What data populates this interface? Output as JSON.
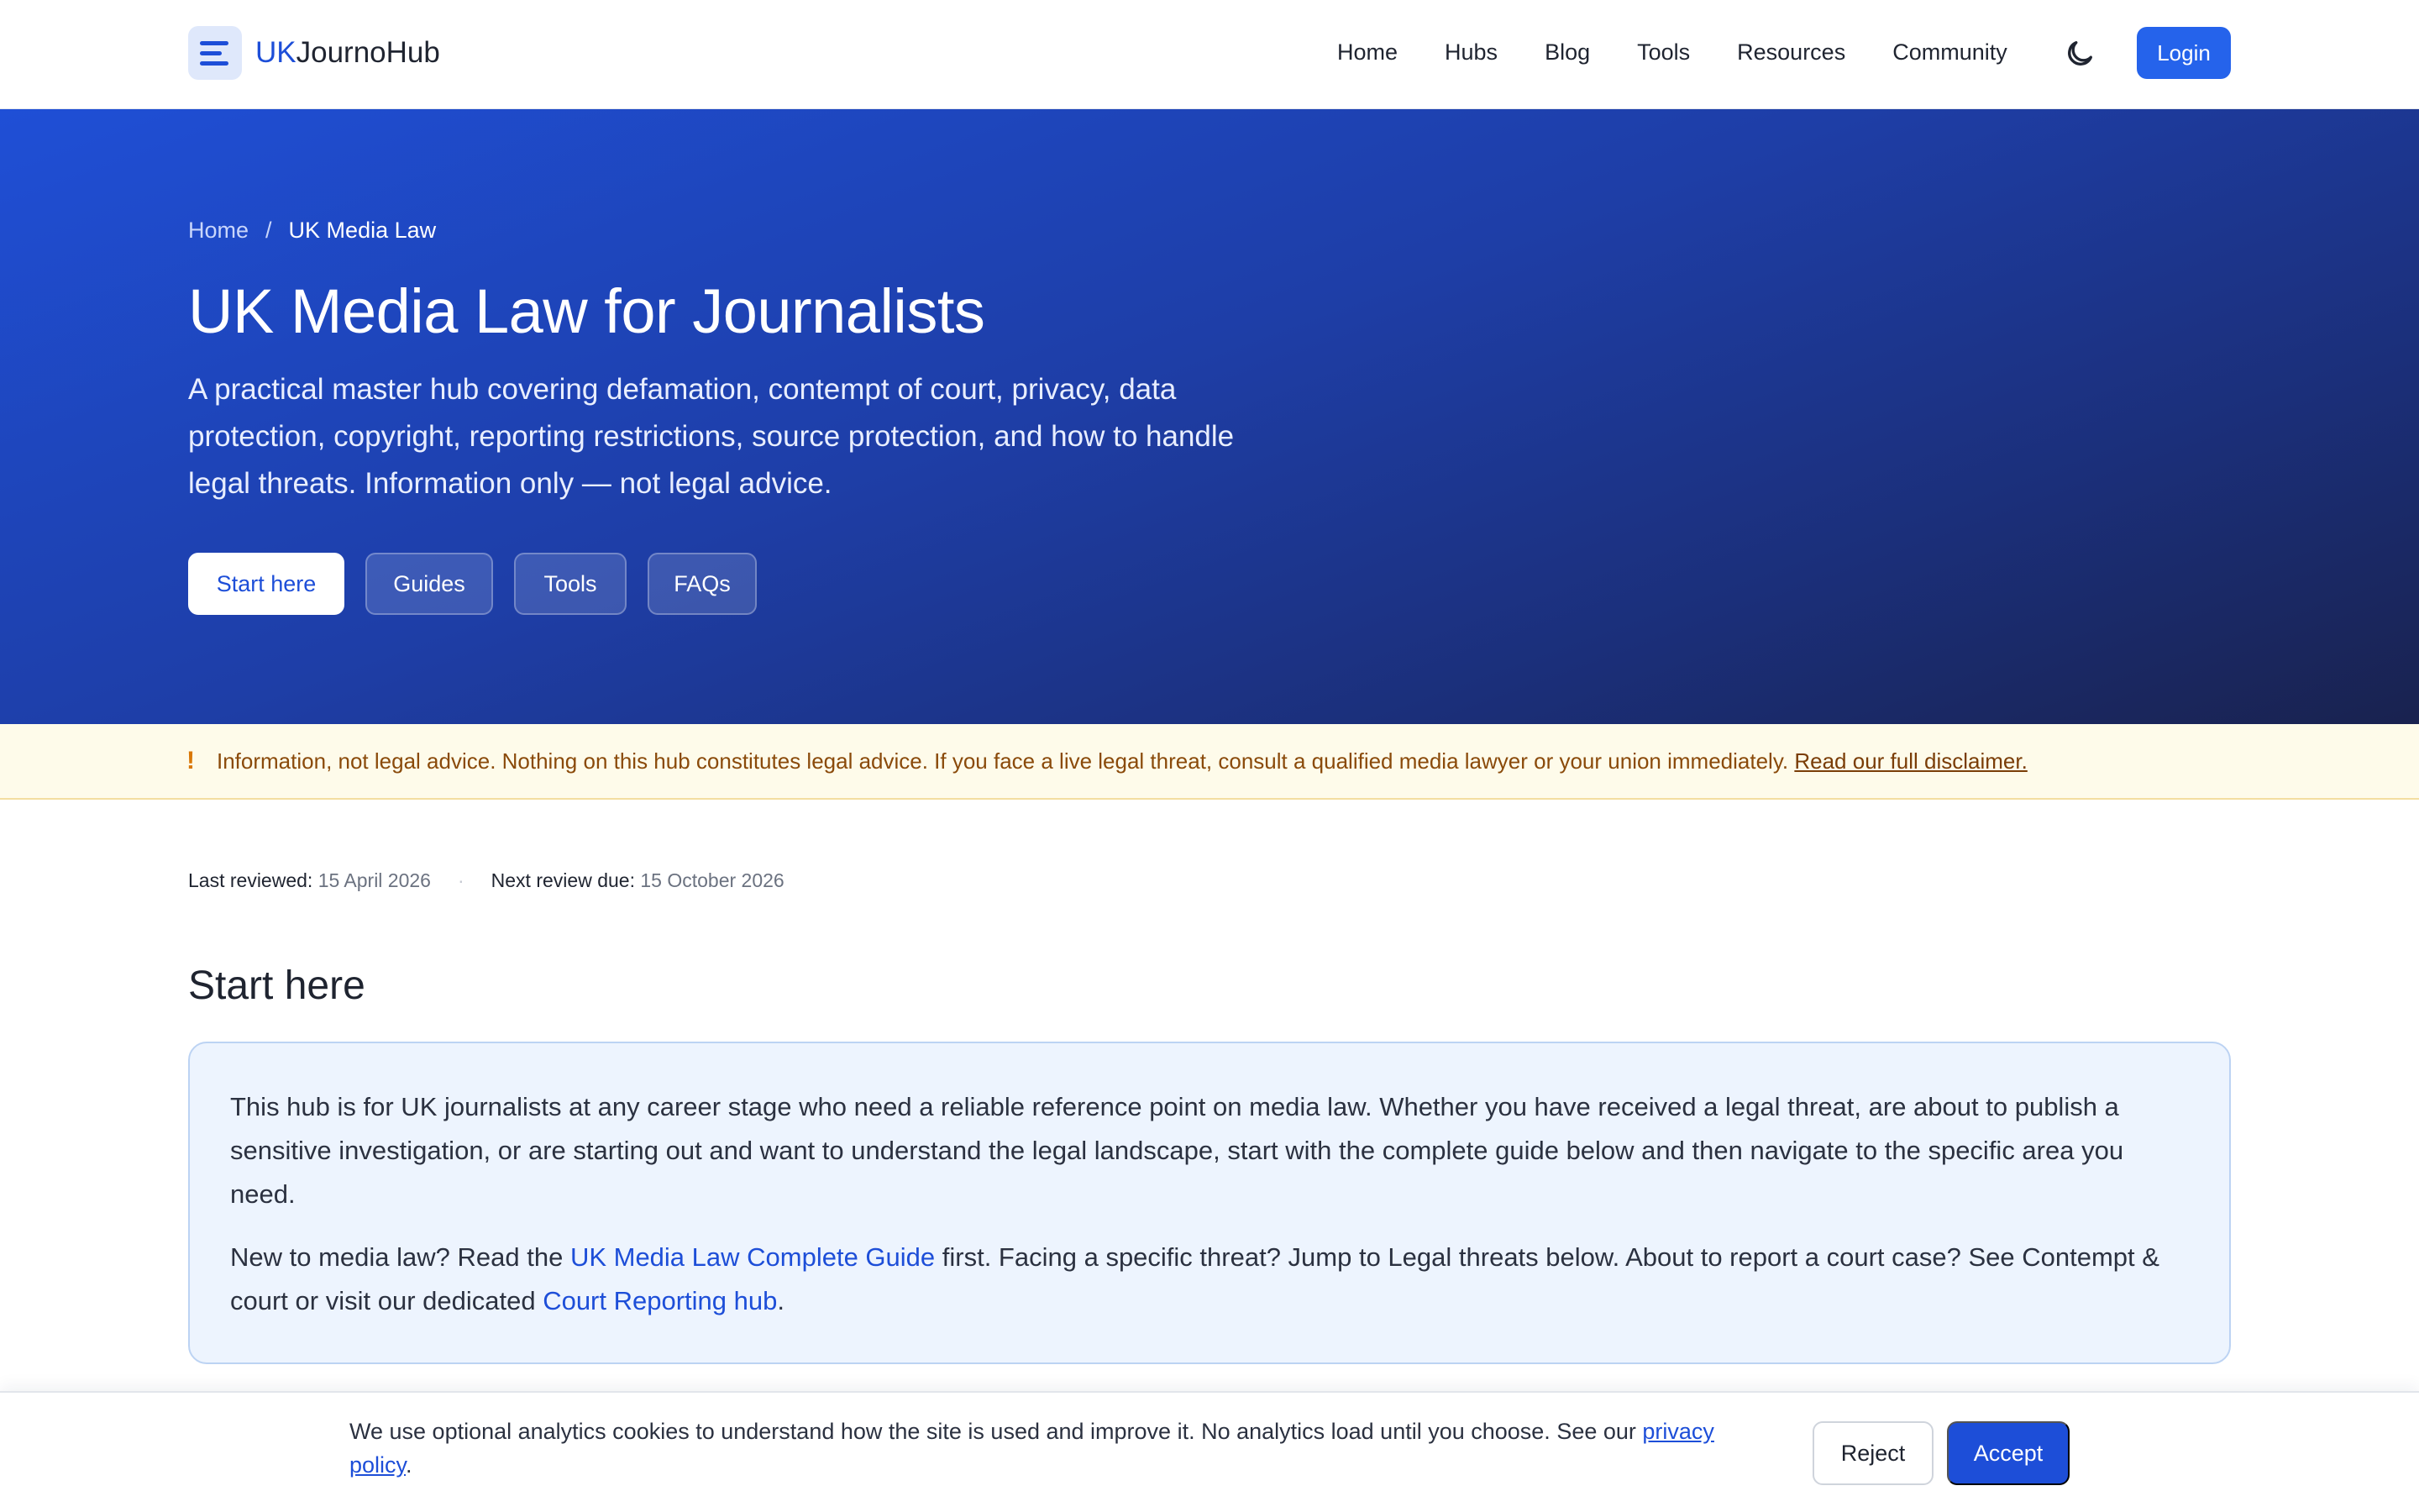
{
  "nav": {
    "logo_prefix": "UK",
    "logo_suffix": "JournoHub",
    "links": [
      "Home",
      "Hubs",
      "Blog",
      "Tools",
      "Resources",
      "Community"
    ],
    "theme_icon": "moon-icon",
    "login_label": "Login"
  },
  "hero": {
    "breadcrumb": {
      "home": "Home",
      "separator": "/",
      "current": "UK Media Law"
    },
    "title": "UK Media Law for Journalists",
    "subtitle": "A practical master hub covering defamation, contempt of court, privacy, data protection, copyright, reporting restrictions, source protection, and how to handle legal threats. Information only — not legal advice.",
    "buttons": {
      "start": "Start here",
      "guides": "Guides",
      "tools": "Tools",
      "faqs": "FAQs"
    }
  },
  "disclaimer": {
    "icon": "!",
    "text": "Information, not legal advice. Nothing on this hub constitutes legal advice. If you face a live legal threat, consult a qualified media lawyer or your union immediately.",
    "link": "Read our full disclaimer."
  },
  "meta": {
    "reviewed_label": "Last reviewed:",
    "reviewed_value": "15 April 2026",
    "next_label": "Next review due:",
    "next_value": "15 October 2026"
  },
  "start_here": {
    "title": "Start here",
    "p1": "This hub is for UK journalists at any career stage who need a reliable reference point on media law. Whether you have received a legal threat, are about to publish a sensitive investigation, or are starting out and want to understand the legal landscape, start with the complete guide below and then navigate to the specific area you need.",
    "p2_a": "New to media law? Read the ",
    "p2_link1": "UK Media Law Complete Guide",
    "p2_b": " first. Facing a specific threat? Jump to Legal threats below. About to report a court case? See Contempt & court or visit our dedicated ",
    "p2_link2": "Court Reporting hub",
    "p2_c": "."
  },
  "cookie": {
    "text": "We use optional analytics cookies to understand how the site is used and improve it. No analytics load until you choose. See our ",
    "link": "privacy policy",
    "end": ".",
    "reject": "Reject",
    "accept": "Accept"
  },
  "colors": {
    "brand": "#1d4ed8",
    "login_bg": "#2563eb",
    "disclaimer_bg": "#fefbea",
    "disclaimer_text": "#8a4a0a",
    "start_box_bg": "#edf4fe"
  }
}
